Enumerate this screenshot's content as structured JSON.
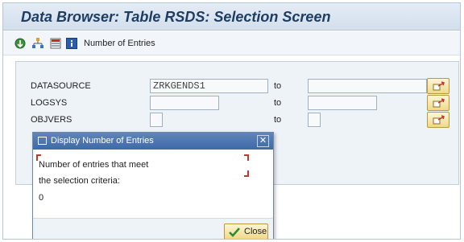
{
  "window": {
    "title": "Data Browser: Table RSDS: Selection Screen"
  },
  "toolbar": {
    "icons": [
      "execute-icon",
      "hierarchy-icon",
      "selection-options-icon",
      "info-icon"
    ],
    "number_of_entries_label": "Number of Entries"
  },
  "form": {
    "rows": [
      {
        "label": "DATASOURCE",
        "value": "ZRKGENDS1",
        "to_label": "to",
        "to_value": ""
      },
      {
        "label": "LOGSYS",
        "value": "",
        "to_label": "to",
        "to_value": ""
      },
      {
        "label": "OBJVERS",
        "value": "",
        "to_label": "to",
        "to_value": ""
      }
    ]
  },
  "dialog": {
    "title": "Display Number of Entries",
    "message_line1": "Number of entries that meet",
    "message_line2": "the selection criteria:",
    "count": "0",
    "close_label": "Close"
  },
  "colors": {
    "title_text": "#1e3d62",
    "dialog_titlebar": "#4a73ad",
    "button_yellow": "#f3e29f",
    "highlight_red": "#c0392b"
  }
}
